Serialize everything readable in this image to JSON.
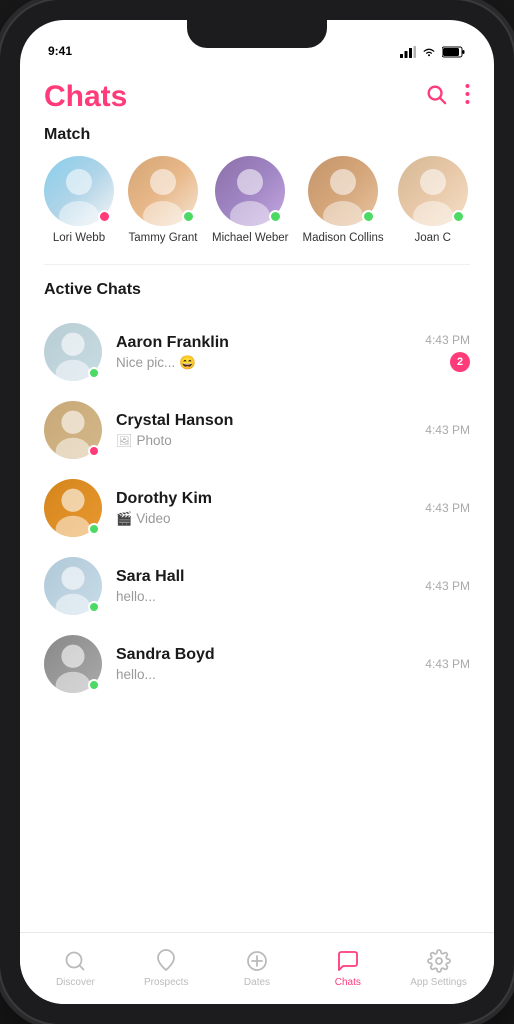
{
  "app": {
    "title": "Chats"
  },
  "header": {
    "title": "Chats",
    "search_label": "Search",
    "more_label": "More options"
  },
  "match_section": {
    "label": "Match",
    "items": [
      {
        "id": "lori",
        "name": "Lori Webb",
        "online": false,
        "avatar_class": "av-lori"
      },
      {
        "id": "tammy",
        "name": "Tammy Grant",
        "online": true,
        "avatar_class": "av-tammy"
      },
      {
        "id": "michael",
        "name": "Michael Weber",
        "online": true,
        "avatar_class": "av-michael"
      },
      {
        "id": "madison",
        "name": "Madison Collins",
        "online": true,
        "avatar_class": "av-madison"
      },
      {
        "id": "joan",
        "name": "Joan C",
        "online": true,
        "avatar_class": "av-joan"
      }
    ]
  },
  "chats_section": {
    "label": "Active Chats",
    "items": [
      {
        "id": "aaron",
        "name": "Aaron Franklin",
        "preview": "Nice pic... 😄",
        "time": "4:43 PM",
        "unread": 2,
        "online": true,
        "avatar_class": "av-aaron",
        "preview_type": "text"
      },
      {
        "id": "crystal",
        "name": "Crystal Hanson",
        "preview": "Photo",
        "time": "4:43 PM",
        "unread": 0,
        "online": false,
        "avatar_class": "av-crystal",
        "preview_type": "photo"
      },
      {
        "id": "dorothy",
        "name": "Dorothy Kim",
        "preview": "Video",
        "time": "4:43 PM",
        "unread": 0,
        "online": true,
        "avatar_class": "av-dorothy",
        "preview_type": "video"
      },
      {
        "id": "sara",
        "name": "Sara Hall",
        "preview": "hello...",
        "time": "4:43 PM",
        "unread": 0,
        "online": true,
        "avatar_class": "av-sara",
        "preview_type": "text"
      },
      {
        "id": "sandra",
        "name": "Sandra Boyd",
        "preview": "hello...",
        "time": "4:43 PM",
        "unread": 0,
        "online": true,
        "avatar_class": "av-sandra",
        "preview_type": "text"
      }
    ]
  },
  "tab_bar": {
    "items": [
      {
        "id": "discover",
        "label": "Discover",
        "icon": "🔍",
        "active": false
      },
      {
        "id": "prospects",
        "label": "Prospects",
        "icon": "♡",
        "active": false
      },
      {
        "id": "dates",
        "label": "Dates",
        "icon": "⊕",
        "active": false
      },
      {
        "id": "chats",
        "label": "Chats",
        "icon": "💬",
        "active": true
      },
      {
        "id": "app-settings",
        "label": "App Settings",
        "icon": "⚙",
        "active": false
      }
    ]
  }
}
